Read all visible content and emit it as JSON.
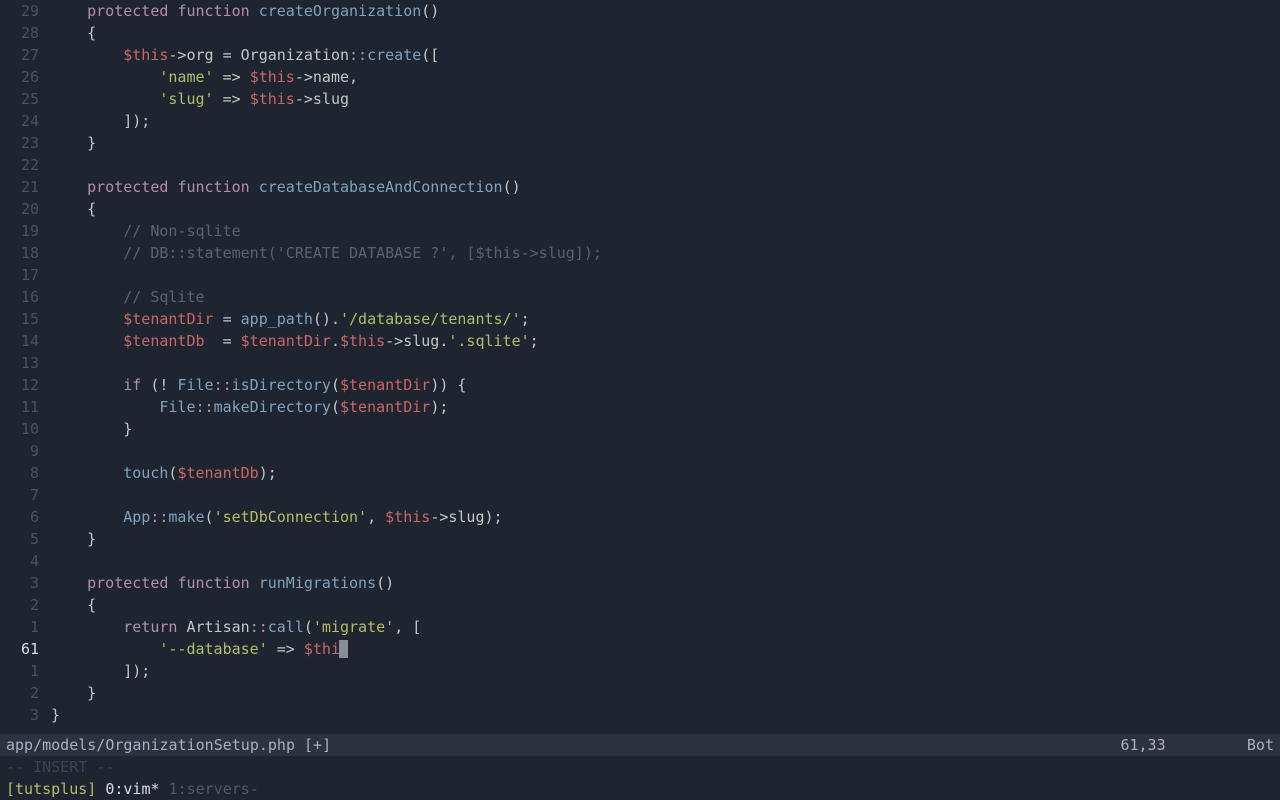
{
  "gutter": [
    "29",
    "28",
    "27",
    "26",
    "25",
    "24",
    "23",
    "22",
    "21",
    "20",
    "19",
    "18",
    "17",
    "16",
    "15",
    "14",
    "13",
    "12",
    "11",
    "10",
    "9",
    "8",
    "7",
    "6",
    "5",
    "4",
    "3",
    "2",
    "1",
    "61",
    "1",
    "2",
    "3"
  ],
  "current_abs_index": 29,
  "code": [
    [
      [
        "    ",
        "t-punc"
      ],
      [
        "protected",
        "t-kw"
      ],
      [
        " ",
        "t-punc"
      ],
      [
        "function",
        "t-kw"
      ],
      [
        " ",
        "t-punc"
      ],
      [
        "createOrganization",
        "t-blue"
      ],
      [
        "()",
        "t-punc"
      ]
    ],
    [
      [
        "    {",
        "t-punc"
      ]
    ],
    [
      [
        "        ",
        "t-punc"
      ],
      [
        "$this",
        "t-var"
      ],
      [
        "->org = Organization",
        "t-punc"
      ],
      [
        "::",
        "t-col"
      ],
      [
        "create",
        "t-blue"
      ],
      [
        "([",
        "t-punc"
      ]
    ],
    [
      [
        "            ",
        "t-punc"
      ],
      [
        "'name'",
        "t-str"
      ],
      [
        " => ",
        "t-punc"
      ],
      [
        "$this",
        "t-var"
      ],
      [
        "->name,",
        "t-punc"
      ]
    ],
    [
      [
        "            ",
        "t-punc"
      ],
      [
        "'slug'",
        "t-str"
      ],
      [
        " => ",
        "t-punc"
      ],
      [
        "$this",
        "t-var"
      ],
      [
        "->slug",
        "t-punc"
      ]
    ],
    [
      [
        "        ]);",
        "t-punc"
      ]
    ],
    [
      [
        "    }",
        "t-punc"
      ]
    ],
    [
      [
        "",
        "t-punc"
      ]
    ],
    [
      [
        "    ",
        "t-punc"
      ],
      [
        "protected",
        "t-kw"
      ],
      [
        " ",
        "t-punc"
      ],
      [
        "function",
        "t-kw"
      ],
      [
        " ",
        "t-punc"
      ],
      [
        "createDatabaseAndConnection",
        "t-blue"
      ],
      [
        "()",
        "t-punc"
      ]
    ],
    [
      [
        "    {",
        "t-punc"
      ]
    ],
    [
      [
        "        ",
        "t-punc"
      ],
      [
        "// Non-sqlite",
        "t-cmt"
      ]
    ],
    [
      [
        "        ",
        "t-punc"
      ],
      [
        "// DB::statement('CREATE DATABASE ?', [$this->slug]);",
        "t-cmt"
      ]
    ],
    [
      [
        "",
        "t-punc"
      ]
    ],
    [
      [
        "        ",
        "t-punc"
      ],
      [
        "// Sqlite",
        "t-cmt"
      ]
    ],
    [
      [
        "        ",
        "t-punc"
      ],
      [
        "$tenantDir",
        "t-var"
      ],
      [
        " = ",
        "t-punc"
      ],
      [
        "app_path",
        "t-blue"
      ],
      [
        "().",
        "t-punc"
      ],
      [
        "'/database/tenants/'",
        "t-str"
      ],
      [
        ";",
        "t-punc"
      ]
    ],
    [
      [
        "        ",
        "t-punc"
      ],
      [
        "$tenantDb",
        "t-var"
      ],
      [
        "  = ",
        "t-punc"
      ],
      [
        "$tenantDir",
        "t-var"
      ],
      [
        ".",
        "t-punc"
      ],
      [
        "$this",
        "t-var"
      ],
      [
        "->slug.",
        "t-punc"
      ],
      [
        "'.sqlite'",
        "t-str"
      ],
      [
        ";",
        "t-punc"
      ]
    ],
    [
      [
        "",
        "t-punc"
      ]
    ],
    [
      [
        "        ",
        "t-punc"
      ],
      [
        "if",
        "t-kw"
      ],
      [
        " (! ",
        "t-punc"
      ],
      [
        "File",
        "t-blue"
      ],
      [
        "::",
        "t-col"
      ],
      [
        "isDirectory",
        "t-blue"
      ],
      [
        "(",
        "t-punc"
      ],
      [
        "$tenantDir",
        "t-var"
      ],
      [
        ")) {",
        "t-punc"
      ]
    ],
    [
      [
        "            ",
        "t-punc"
      ],
      [
        "File",
        "t-blue"
      ],
      [
        "::",
        "t-col"
      ],
      [
        "makeDirectory",
        "t-blue"
      ],
      [
        "(",
        "t-punc"
      ],
      [
        "$tenantDir",
        "t-var"
      ],
      [
        ");",
        "t-punc"
      ]
    ],
    [
      [
        "        }",
        "t-punc"
      ]
    ],
    [
      [
        "",
        "t-punc"
      ]
    ],
    [
      [
        "        ",
        "t-punc"
      ],
      [
        "touch",
        "t-blue"
      ],
      [
        "(",
        "t-punc"
      ],
      [
        "$tenantDb",
        "t-var"
      ],
      [
        ");",
        "t-punc"
      ]
    ],
    [
      [
        "",
        "t-punc"
      ]
    ],
    [
      [
        "        ",
        "t-punc"
      ],
      [
        "App",
        "t-blue"
      ],
      [
        "::",
        "t-col"
      ],
      [
        "make",
        "t-blue"
      ],
      [
        "(",
        "t-punc"
      ],
      [
        "'setDbConnection'",
        "t-str"
      ],
      [
        ", ",
        "t-punc"
      ],
      [
        "$this",
        "t-var"
      ],
      [
        "->slug);",
        "t-punc"
      ]
    ],
    [
      [
        "    }",
        "t-punc"
      ]
    ],
    [
      [
        "",
        "t-punc"
      ]
    ],
    [
      [
        "    ",
        "t-punc"
      ],
      [
        "protected",
        "t-kw"
      ],
      [
        " ",
        "t-punc"
      ],
      [
        "function",
        "t-kw"
      ],
      [
        " ",
        "t-punc"
      ],
      [
        "runMigrations",
        "t-blue"
      ],
      [
        "()",
        "t-punc"
      ]
    ],
    [
      [
        "    {",
        "t-punc"
      ]
    ],
    [
      [
        "        ",
        "t-punc"
      ],
      [
        "return",
        "t-kw"
      ],
      [
        " Artisan",
        "t-punc"
      ],
      [
        "::",
        "t-col"
      ],
      [
        "call",
        "t-blue"
      ],
      [
        "(",
        "t-punc"
      ],
      [
        "'migrate'",
        "t-str"
      ],
      [
        ", [",
        "t-punc"
      ]
    ],
    [
      [
        "            ",
        "t-punc"
      ],
      [
        "'--database'",
        "t-str"
      ],
      [
        " => ",
        "t-punc"
      ],
      [
        "$thi",
        "t-var"
      ]
    ],
    [
      [
        "        ]);",
        "t-punc"
      ]
    ],
    [
      [
        "    }",
        "t-punc"
      ]
    ],
    [
      [
        "}",
        "t-punc"
      ]
    ]
  ],
  "cursor_row": 29,
  "status": {
    "file": "app/models/OrganizationSetup.php [+]",
    "pos": "61,33",
    "scroll": "Bot"
  },
  "mode": "-- INSERT --",
  "tmux": {
    "session": "[tutsplus]",
    "win0": "0:vim*",
    "win1": "1:servers-"
  }
}
